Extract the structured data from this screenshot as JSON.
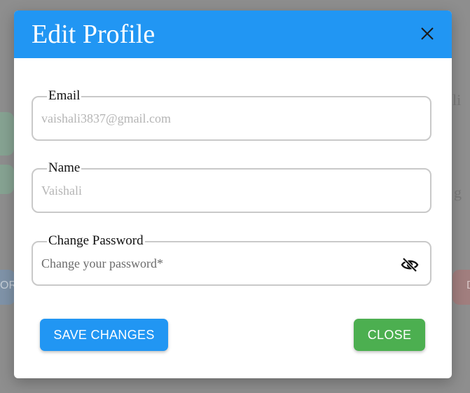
{
  "modal": {
    "title": "Edit Profile",
    "close_icon": "close-icon"
  },
  "fields": {
    "email": {
      "label": "Email",
      "placeholder": "vaishali3837@gmail.com"
    },
    "name": {
      "label": "Name",
      "placeholder": "Vaishali"
    },
    "password": {
      "label": "Change Password",
      "placeholder": "Change your password*",
      "toggle_icon": "eye-off-icon"
    }
  },
  "buttons": {
    "save_label": "SAVE CHANGES",
    "close_label": "CLOSE"
  },
  "background": {
    "left_button_fragment": "OR",
    "right_button_fragment": "D",
    "text_fragment_1": "li",
    "text_fragment_2": "g"
  },
  "colors": {
    "header": "#2196f3",
    "save": "#2196f3",
    "close": "#4caf50",
    "overlay": "#8d8d8d"
  }
}
